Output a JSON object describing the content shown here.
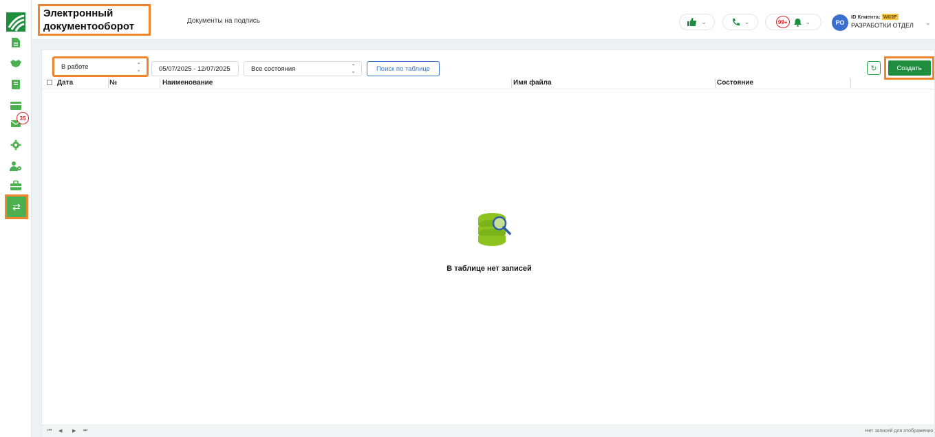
{
  "header": {
    "app_title": "Электронный документооборот",
    "nav_link": "Документы на подпись",
    "notifications_count": "99+",
    "avatar_initials": "РО",
    "client_id_label": "ID Клиента:",
    "client_id_value": "W03F",
    "department": "РАЗРАБОТКИ ОТДЕЛ"
  },
  "sidebar": {
    "badge_count": "35",
    "items": [
      "document-icon",
      "handshake-icon",
      "book-icon",
      "card-icon",
      "mail-icon",
      "gear-icon",
      "user-gear-icon",
      "briefcase-icon",
      "exchange-icon"
    ]
  },
  "toolbar": {
    "status_select": "В работе",
    "date_range": "05/07/2025 - 12/07/2025",
    "state_select": "Все состояния",
    "search_button": "Поиск по таблице",
    "create_button": "Создать"
  },
  "table": {
    "columns": [
      "Дата",
      "№",
      "Наименование",
      "Имя файла",
      "Состояние"
    ],
    "empty_message": "В таблице нет записей"
  },
  "footer": {
    "pager_first": "⏮",
    "pager_prev": "◀",
    "pager_next": "▶",
    "pager_last": "⏭",
    "info": "Нет записей для отображения"
  },
  "colors": {
    "accent_green": "#4caf50",
    "primary_green": "#1e8e3e",
    "highlight_orange": "#f0842c",
    "link_blue": "#3a78d4",
    "badge_red": "#d9262a"
  }
}
